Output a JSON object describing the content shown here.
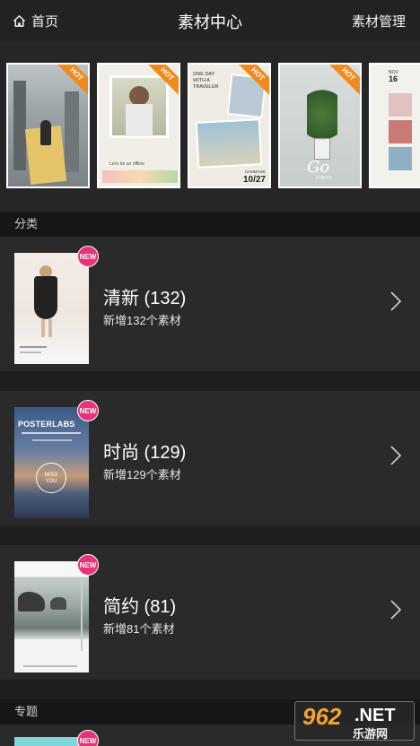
{
  "header": {
    "back_label": "首页",
    "title": "素材中心",
    "manage_label": "素材管理"
  },
  "hot_badge": "HOT",
  "hot_items": [
    {
      "icon": "poster-thumbnail"
    },
    {
      "icon": "poster-thumbnail",
      "caption": "Let's be an offline"
    },
    {
      "icon": "poster-thumbnail",
      "heading": "ONE DAY\nWITH A\nTRAVELER",
      "date": "10/27",
      "tag": "CHNMAGE"
    },
    {
      "icon": "poster-thumbnail",
      "script": "Go",
      "sub": "FOR IT!"
    },
    {
      "icon": "poster-thumbnail",
      "month": "NOV",
      "day": "16"
    }
  ],
  "sections": {
    "category": "分类",
    "topic": "专题"
  },
  "new_badge": "NEW",
  "categories": [
    {
      "name": "清新 (132)",
      "sub": "新增132个素材"
    },
    {
      "name": "时尚 (129)",
      "sub": "新增129个素材",
      "cover_title": "POSTERLABS",
      "cover_badge": "MISS\nYOU"
    },
    {
      "name": "简约 (81)",
      "sub": "新增81个素材"
    }
  ],
  "watermark": {
    "number": "962",
    "domain": ".NET",
    "site": "乐游网"
  },
  "colors": {
    "background": "#1b1b1b",
    "header": "#222222",
    "row": "#2a2a2a",
    "hot": "#f08a1d",
    "new": "#e8327a"
  }
}
